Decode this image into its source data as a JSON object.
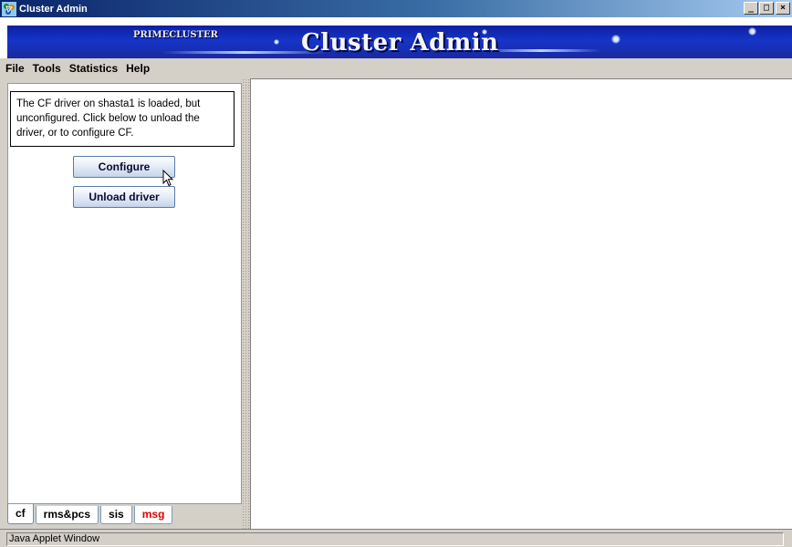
{
  "window": {
    "title": "Cluster Admin"
  },
  "banner": {
    "brand": "PRIMECLUSTER",
    "title": "Cluster Admin"
  },
  "menu": [
    "File",
    "Tools",
    "Statistics",
    "Help"
  ],
  "left_panel": {
    "message": "The CF driver on shasta1 is loaded, but unconfigured.  Click below to unload the driver, or to configure CF.",
    "buttons": {
      "configure": "Configure",
      "unload": "Unload driver"
    }
  },
  "tabs": [
    {
      "label": "cf",
      "active": true,
      "color": "#000000"
    },
    {
      "label": "rms&pcs",
      "active": false,
      "color": "#000000"
    },
    {
      "label": "sis",
      "active": false,
      "color": "#000000"
    },
    {
      "label": "msg",
      "active": false,
      "color": "#e00000"
    }
  ],
  "status": {
    "text": "Java Applet Window"
  },
  "icons": {
    "app": "cluster-app-icon",
    "minimize": "minimize-icon",
    "maximize": "maximize-icon",
    "close": "close-icon",
    "cursor": "mouse-pointer-icon"
  }
}
